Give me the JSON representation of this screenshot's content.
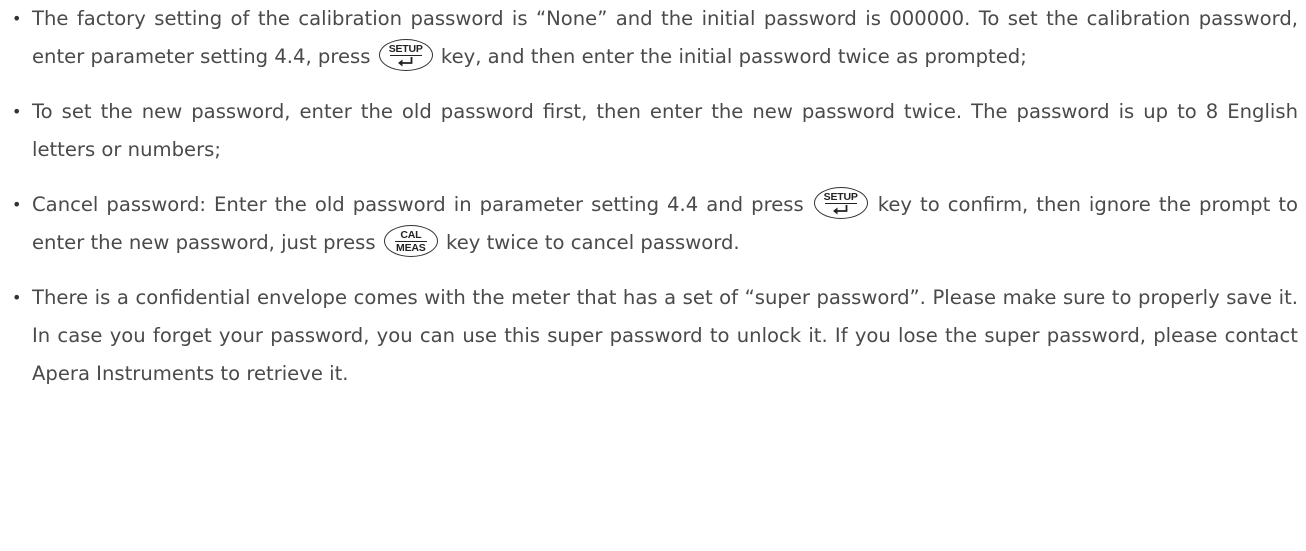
{
  "keys": {
    "setup": {
      "top": "SETUP",
      "bottom_icon": "enter-arrow-icon"
    },
    "cal_meas": {
      "top": "CAL",
      "bottom": "MEAS"
    }
  },
  "bullets": [
    {
      "t1": "The factory setting of the calibration password is “None” and the initial password is 000000. To set the calibration password, enter parameter setting 4.4, press ",
      "t2": " key, and then enter the initial password twice as prompted;"
    },
    {
      "t1": "To set the new password, enter the old password first, then enter the new password twice. The password is up to 8 English letters or numbers;"
    },
    {
      "t1": "Cancel password: Enter the old password in parameter setting 4.4 and press ",
      "t2": " key to confirm, then ignore the prompt to enter the new password, just press ",
      "t3": " key twice to cancel password."
    },
    {
      "t1": "There is a confidential envelope comes with the meter that has a set of “super password”. Please make sure to properly save it. In case you forget your password, you can use this super password to unlock it. If you lose the super password, please contact Apera Instruments to retrieve it."
    }
  ]
}
